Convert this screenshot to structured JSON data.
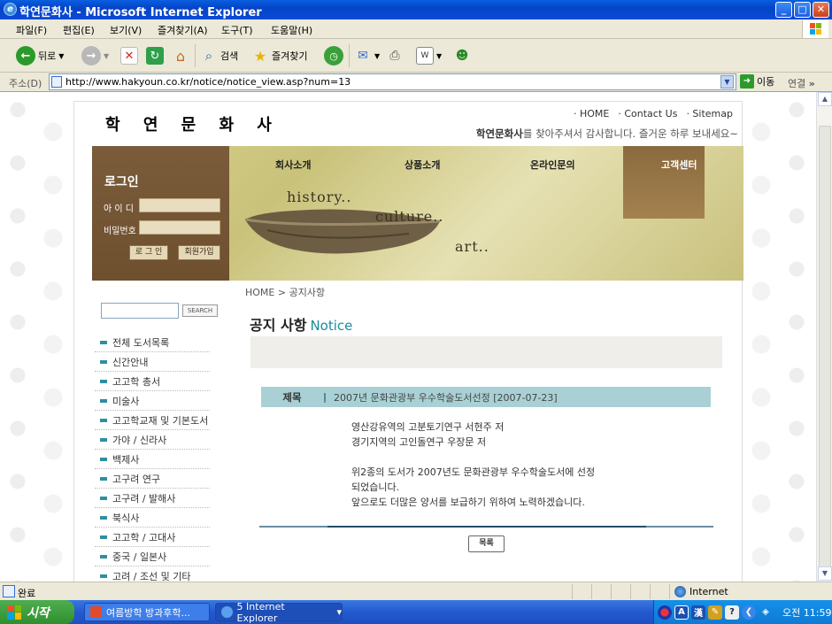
{
  "window": {
    "title": "학연문화사 - Microsoft Internet Explorer",
    "buttons": {
      "minimize": "_",
      "maximize": "□",
      "close": "✕"
    }
  },
  "menu": [
    "파일(F)",
    "편집(E)",
    "보기(V)",
    "즐겨찾기(A)",
    "도구(T)",
    "도움말(H)"
  ],
  "toolbar": {
    "back_label": "뒤로",
    "search_label": "검색",
    "favorites_label": "즐겨찾기"
  },
  "address": {
    "label": "주소(D)",
    "url": "http://www.hakyoun.co.kr/notice/notice_view.asp?num=13",
    "go_label": "이동",
    "links_label": "연결",
    "more": "»"
  },
  "site": {
    "logo": "학 연 문 화 사",
    "toplinks": [
      "· HOME",
      "· Contact Us",
      "· Sitemap"
    ],
    "welcome_brand": "학연문화사",
    "welcome_rest": "를 찾아주셔서 감사합니다. 즐거운 하루 보내세요~",
    "login": {
      "title": "로그인",
      "id_label": "아 이 디",
      "pw_label": "비밀번호",
      "login_btn": "로 그 인",
      "join_btn": "회원가입"
    },
    "nav": [
      "회사소개",
      "상품소개",
      "온라인문의",
      "고객센터"
    ],
    "banner_words": [
      "history..",
      "culture..",
      "art.."
    ],
    "breadcrumb": "HOME > 공지사항",
    "search_btn": "SEARCH",
    "categories": [
      "전체 도서목록",
      "신간안내",
      "고고학 총서",
      "미술사",
      "고고학교재 및 기본도서",
      "가야 / 신라사",
      "백제사",
      "고구려 연구",
      "고구려 / 발해사",
      "북식사",
      "고고학 / 고대사",
      "중국 / 일본사",
      "고려 / 조선 및 기타"
    ]
  },
  "notice": {
    "heading_ko": "공지 사항",
    "heading_en": "Notice",
    "subject_label": "제목",
    "subject_value": "2007년 문화관광부 우수학술도서선정 [2007-07-23]",
    "body_lines": [
      "영산강유역의 고분토기연구 서현주 저",
      "경기지역의 고인돌연구 우장문 저",
      "",
      "위2종의 도서가 2007년도 문화관광부 우수학술도서에 선정",
      "되었습니다.",
      "앞으로도 더많은 양서를 보급하기 위하여 노력하겠습니다."
    ],
    "list_btn": "목록"
  },
  "status": {
    "text": "완료",
    "zone": "Internet"
  },
  "taskbar": {
    "start": "시작",
    "tasks": [
      "여름방학 방과후학...",
      "5 Internet Explorer"
    ],
    "task_dropdown": "▾",
    "tray_lang": "A",
    "tray_hanja": "漢",
    "clock": "오전 11:59"
  }
}
